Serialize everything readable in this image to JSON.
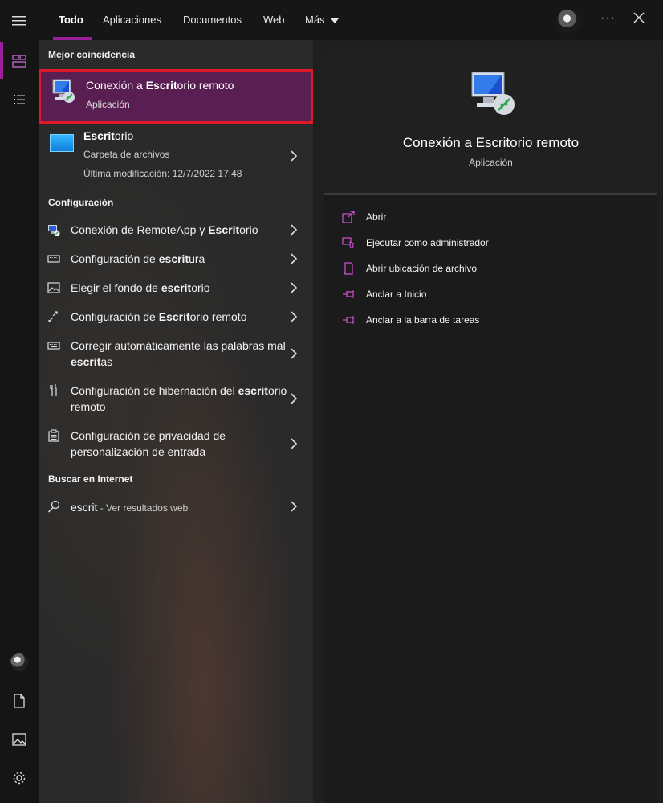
{
  "colors": {
    "accent": "#9b1e9a",
    "highlight_border": "#e0192a",
    "selected_bg": "#5a1f52",
    "action_icon": "#d34fd3"
  },
  "tabs": [
    {
      "label": "Todo",
      "active": true
    },
    {
      "label": "Aplicaciones"
    },
    {
      "label": "Documentos"
    },
    {
      "label": "Web"
    },
    {
      "label": "Más"
    }
  ],
  "rail": {
    "top_icons": [
      "hamburger-icon",
      "all-apps-icon",
      "list-icon"
    ],
    "bottom_icons": [
      "avatar",
      "document-icon",
      "image-icon",
      "gear-icon"
    ]
  },
  "best_match": {
    "heading": "Mejor coincidencia",
    "title_pre": "Conexión a ",
    "title_bold": "Escrit",
    "title_post": "orio remoto",
    "subtitle": "Aplicación"
  },
  "file_result": {
    "title_bold": "Escrit",
    "title_post": "orio",
    "type": "Carpeta de archivos",
    "modified": "Última modificación: 12/7/2022 17:48"
  },
  "settings": {
    "heading": "Configuración",
    "items": [
      {
        "pre": "Conexión de RemoteApp y ",
        "bold": "Escrit",
        "post": "orio",
        "icon": "remoteapp-icon"
      },
      {
        "pre": "Configuración de ",
        "bold": "escrit",
        "post": "ura",
        "icon": "keyboard-icon"
      },
      {
        "pre": "Elegir el fondo de ",
        "bold": "escrit",
        "post": "orio",
        "icon": "picture-icon"
      },
      {
        "pre": "Configuración de ",
        "bold": "Escrit",
        "post": "orio remoto",
        "icon": "remote-arrows-icon"
      },
      {
        "pre": "Corregir automáticamente las palabras mal ",
        "bold": "escrit",
        "post": "as",
        "icon": "keyboard-icon"
      },
      {
        "pre": "Configuración de hibernación del ",
        "bold": "escrit",
        "post": "orio remoto",
        "icon": "tools-icon"
      },
      {
        "pre": "Configuración de privacidad de personalización de entrada",
        "bold": "",
        "post": "",
        "icon": "clipboard-icon"
      }
    ]
  },
  "web": {
    "heading": "Buscar en Internet",
    "query": "escrit",
    "suffix": " - Ver resultados web"
  },
  "detail": {
    "title": "Conexión a Escritorio remoto",
    "subtitle": "Aplicación",
    "actions": [
      {
        "label": "Abrir",
        "icon": "open-icon"
      },
      {
        "label": "Ejecutar como administrador",
        "icon": "shield-icon"
      },
      {
        "label": "Abrir ubicación de archivo",
        "icon": "file-location-icon"
      },
      {
        "label": "Anclar a Inicio",
        "icon": "pin-icon"
      },
      {
        "label": "Anclar a la barra de tareas",
        "icon": "pin-icon"
      }
    ]
  },
  "top": {
    "more": "···"
  }
}
